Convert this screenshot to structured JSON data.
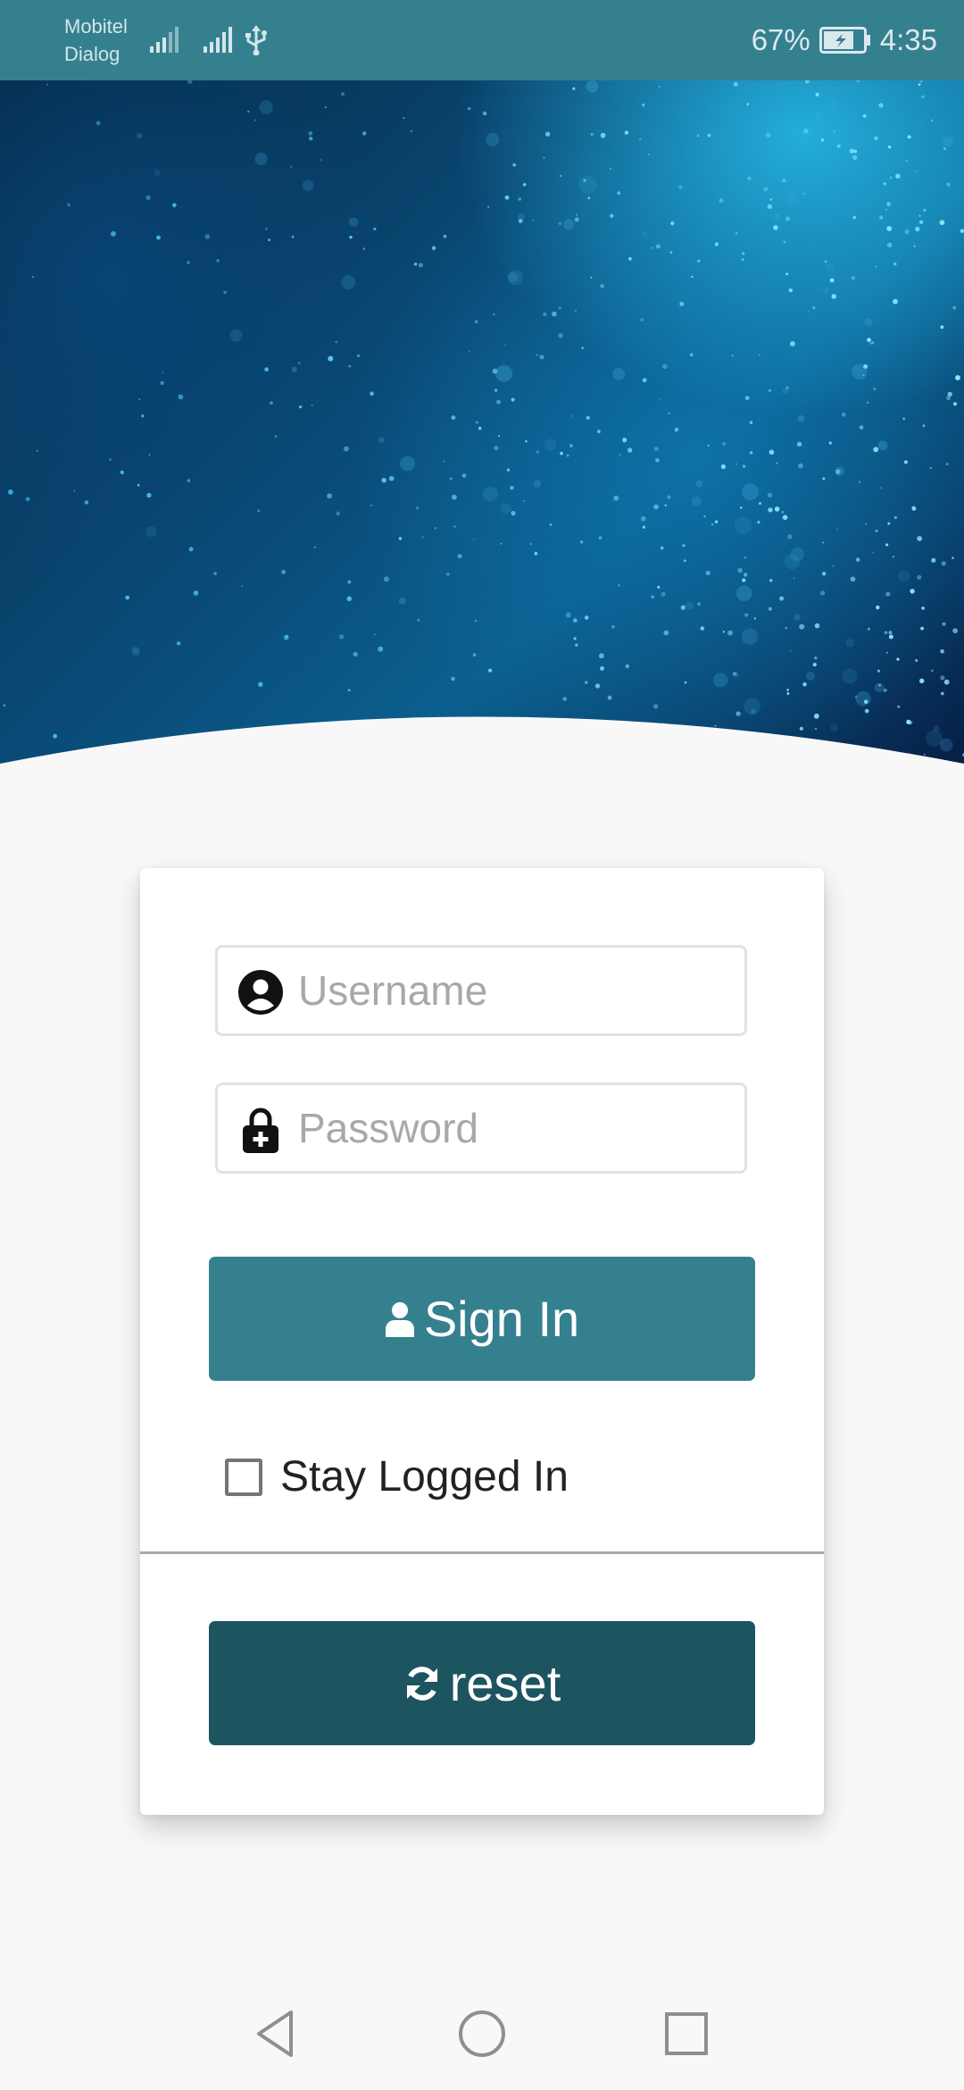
{
  "status_bar": {
    "carrier_1": "Mobitel",
    "carrier_2": "Dialog",
    "battery_percent": "67%",
    "time": "4:35"
  },
  "login": {
    "username_placeholder": "Username",
    "password_placeholder": "Password",
    "sign_in_label": "Sign In",
    "stay_logged_in_label": "Stay Logged In",
    "stay_logged_in_checked": false,
    "reset_label": "reset"
  },
  "icons": {
    "signal_1": "signal-icon",
    "signal_2": "signal-icon",
    "usb": "usb-icon",
    "battery": "battery-charging-icon",
    "username": "user-circle-icon",
    "password": "lock-plus-icon",
    "sign_in": "user-icon",
    "reset": "refresh-icon",
    "nav_back": "back-triangle-icon",
    "nav_home": "home-circle-icon",
    "nav_recents": "recents-square-icon"
  },
  "colors": {
    "status_bar": "#35808f",
    "primary_button": "#35808f",
    "secondary_button": "#1c5460",
    "background": "#f8f8f8",
    "card": "#ffffff"
  }
}
